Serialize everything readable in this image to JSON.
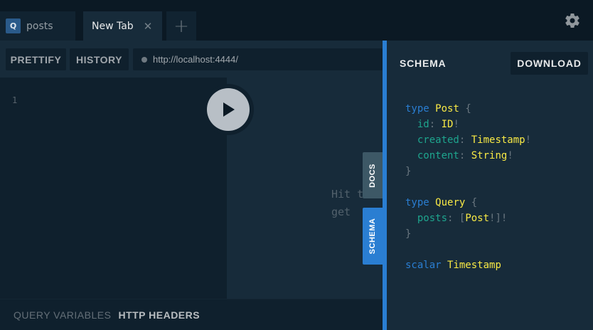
{
  "tabs": [
    {
      "badge": "Q",
      "label": "posts"
    },
    {
      "label": "New Tab",
      "close": "✕"
    }
  ],
  "add_tab": "+",
  "toolbar": {
    "prettify": "PRETTIFY",
    "history": "HISTORY",
    "url": "http://localhost:4444/"
  },
  "editor": {
    "line_number": "1",
    "hint": "Hit t\nget"
  },
  "bottom": {
    "query_variables": "QUERY VARIABLES",
    "http_headers": "HTTP HEADERS"
  },
  "side_tabs": {
    "docs": "DOCS",
    "schema": "SCHEMA"
  },
  "schema_panel": {
    "title": "SCHEMA",
    "download": "DOWNLOAD",
    "code": {
      "post_kw": "type",
      "post_name": "Post",
      "open": "{",
      "close": "}",
      "f1_name": "id",
      "f1_type": "ID",
      "f2_name": "created",
      "f2_type": "Timestamp",
      "f3_name": "content",
      "f3_type": "String",
      "query_kw": "type",
      "query_name": "Query",
      "f4_name": "posts",
      "f4_type": "Post",
      "scalar_kw": "scalar",
      "scalar_name": "Timestamp"
    }
  },
  "colors": {
    "accent": "#2a7ed2",
    "type_name": "#f8e945",
    "field": "#1ea58e",
    "background": "#0f202d",
    "panel": "#172b3a"
  },
  "icons": [
    "settings-gear-icon",
    "play-icon",
    "close-icon",
    "plus-icon"
  ]
}
